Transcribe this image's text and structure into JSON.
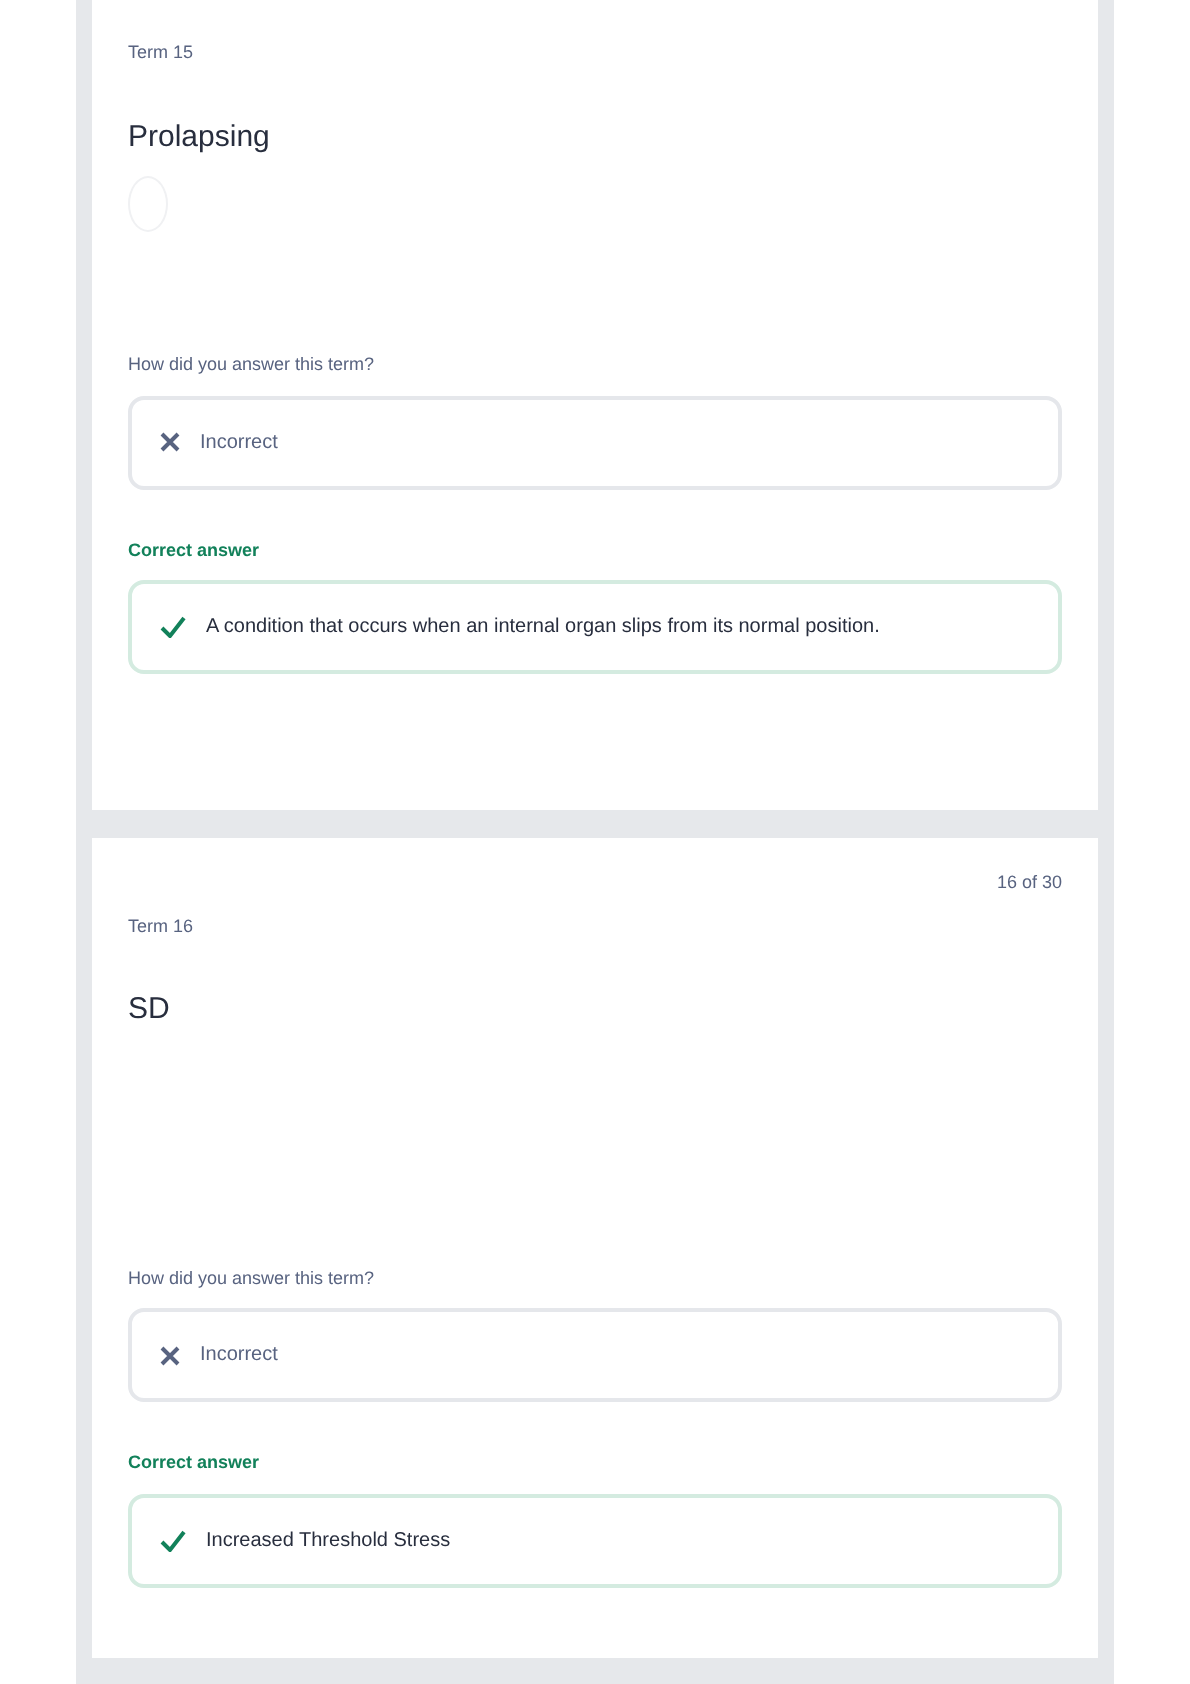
{
  "cards": [
    {
      "term_label": "Term 15",
      "term": "Prolapsing",
      "has_image": true,
      "question": "How did you answer this term?",
      "result": {
        "kind": "incorrect",
        "text": "Incorrect"
      },
      "answer_label": "Correct answer",
      "answer": "A condition that occurs when an internal organ slips from its normal position."
    },
    {
      "counter": "16 of 30",
      "term_label": "Term 16",
      "term": "SD",
      "has_image": false,
      "question": "How did you answer this term?",
      "result": {
        "kind": "incorrect",
        "text": "Incorrect"
      },
      "answer_label": "Correct answer",
      "answer": "Increased Threshold Stress"
    }
  ]
}
